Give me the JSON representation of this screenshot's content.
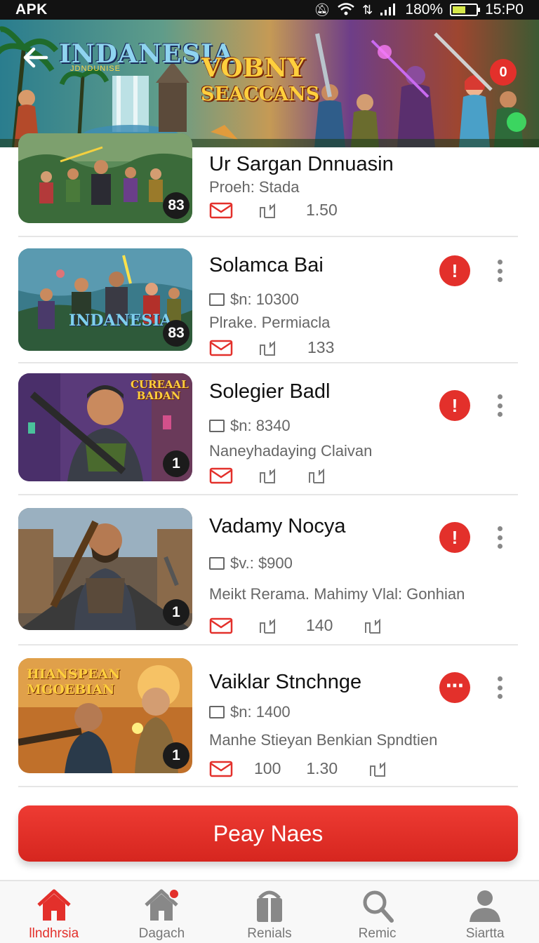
{
  "status_bar": {
    "left": "APK",
    "battery_percent": "180%",
    "time": "15:P0",
    "icons": [
      "mute-icon",
      "wifi-icon",
      "data-icon",
      "signal-icon",
      "battery-icon"
    ]
  },
  "banner": {
    "title_1": "INDANESIA",
    "subtitle_1": "JDNDUNISE",
    "title_2_line_1": "VOBNY",
    "title_2_line_2": "SEACCANS",
    "badge": "0",
    "back_icon": "arrow-left-icon"
  },
  "items": [
    {
      "title": "Ur Sargan Dnnuasin",
      "meta": "Proeh: Stada",
      "stats": [
        "1.50"
      ],
      "badge": "83",
      "thumb_text": ""
    },
    {
      "title": "Solamca Bai",
      "meta": "$n: 10300",
      "sub": "Plrake. Permiacla",
      "stats": [
        "133"
      ],
      "badge": "83",
      "thumb_text": "INDANESIA",
      "action": "!"
    },
    {
      "title": "Solegier Badl",
      "meta": "$n: 8340",
      "sub": "Naneyhadaying Claivan",
      "badge": "1",
      "thumb_text": "CUREAAL BADAN",
      "action": "!"
    },
    {
      "title": "Vadamy Nocya",
      "meta": "$v.: $900",
      "sub": "Meikt Rerama. Mahimy Vlal: Gonhian",
      "stats": [
        "140"
      ],
      "badge": "1",
      "thumb_text": "",
      "action": "!"
    },
    {
      "title": "Vaiklar Stnchnge",
      "meta": "$n: 1400",
      "sub": "Manhe Stieyan Benkian Spndtien",
      "stats": [
        "100",
        "1.30"
      ],
      "badge": "1",
      "thumb_text": "HIANSPEAN MGOEBIAN",
      "action": "⋯"
    }
  ],
  "primary_button": "Peay Naes",
  "bottom_nav": [
    {
      "label": "llndhrsia",
      "icon": "home-icon",
      "active": true
    },
    {
      "label": "Dagach",
      "icon": "home-notification-icon",
      "active": false
    },
    {
      "label": "Renials",
      "icon": "briefcase-icon",
      "active": false
    },
    {
      "label": "Remic",
      "icon": "search-icon",
      "active": false
    },
    {
      "label": "Siartta",
      "icon": "profile-icon",
      "active": false
    }
  ],
  "colors": {
    "accent": "#e3302b",
    "text_primary": "#111111",
    "text_secondary": "#666666",
    "status_bar": "#121212"
  }
}
